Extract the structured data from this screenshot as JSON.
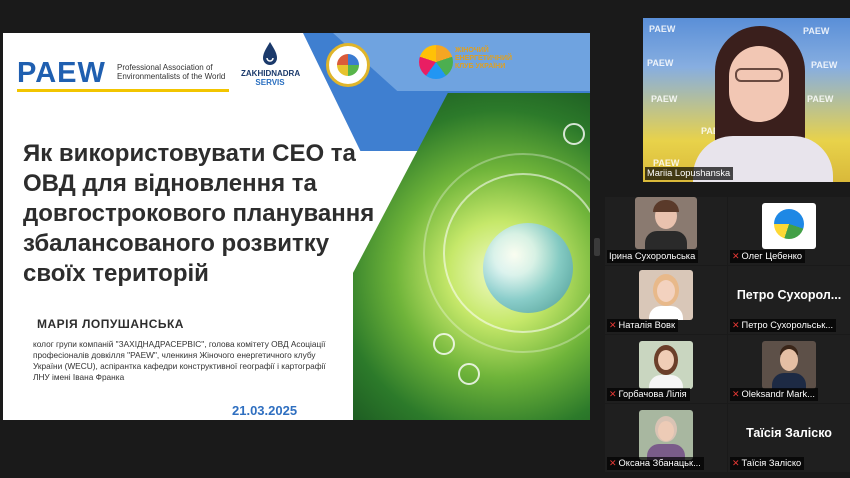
{
  "slide": {
    "paew_logo": "PAEW",
    "paew_sub": "Professional Association of Environmentalists of the World",
    "zakh_logo_line1": "ZAKHIDNADRA",
    "zakh_logo_line2": "SERVIS",
    "wecu_logo_text": "ЖІНОЧИЙ ЕНЕРГЕТИЧНИЙ КЛУБ УКРАЇНИ",
    "title": "Як використовувати СЕО та ОВД для відновлення та довгострокового планування збалансованого розвитку своїх територій",
    "author": "МАРІЯ ЛОПУШАНСЬКА",
    "bio": "колог групи компаній \"ЗАХІДНАДРАСЕРВІС\", голова комітету ОВД Асоціації професіоналів довкілля \"PAEW\", членкиня Жіночого енергетичного клубу України (WECU), аспірантка кафедри конструктивної географії і картографії ЛНУ імені Івана Франка",
    "date": "21.03.2025"
  },
  "speaker": {
    "name": "Mariia Lopushanska",
    "watermark": "PAEW"
  },
  "participants": [
    {
      "name": "Ірина Сухорольська",
      "muted": false,
      "has_video": true
    },
    {
      "name": "Олег Цебенко",
      "muted": true,
      "has_video": true
    },
    {
      "name": "Наталія Вовк",
      "muted": true,
      "has_video": true
    },
    {
      "name": "Петро Сухорольськ...",
      "display_name": "Петро Сухорол...",
      "muted": true,
      "has_video": false
    },
    {
      "name": "Горбачова Лілія",
      "muted": true,
      "has_video": true
    },
    {
      "name": "Oleksandr Mark...",
      "muted": true,
      "has_video": true
    },
    {
      "name": "Оксана Збанацьк...",
      "muted": true,
      "has_video": true
    },
    {
      "name": "Таїсія Заліско",
      "display_name": "Таїсія Заліско",
      "muted": true,
      "has_video": false
    }
  ],
  "colors": {
    "background": "#1a1a1a",
    "paew_blue": "#1f5fb0",
    "date_blue": "#2f6fc0",
    "mic_off": "#e53935"
  },
  "icons": {
    "edit": "pencil-icon",
    "mic_off": "microphone-off-icon"
  }
}
